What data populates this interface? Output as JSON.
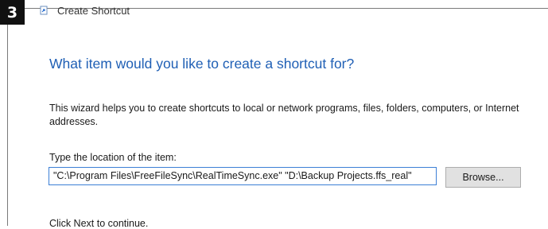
{
  "step": {
    "number": "3"
  },
  "window": {
    "title": "Create Shortcut",
    "icon": "shortcut-icon"
  },
  "wizard": {
    "heading": "What item would you like to create a shortcut for?",
    "description": "This wizard helps you to create shortcuts to local or network programs, files, folders, computers, or Internet addresses.",
    "location_label": "Type the location of the item:",
    "location_value": "\"C:\\Program Files\\FreeFileSync\\RealTimeSync.exe\" \"D:\\Backup Projects.ffs_real\"",
    "browse_label": "Browse...",
    "footer": "Click Next to continue."
  },
  "colors": {
    "heading": "#1f5fb5",
    "input_border": "#3c7fd6",
    "badge_bg": "#111111"
  }
}
